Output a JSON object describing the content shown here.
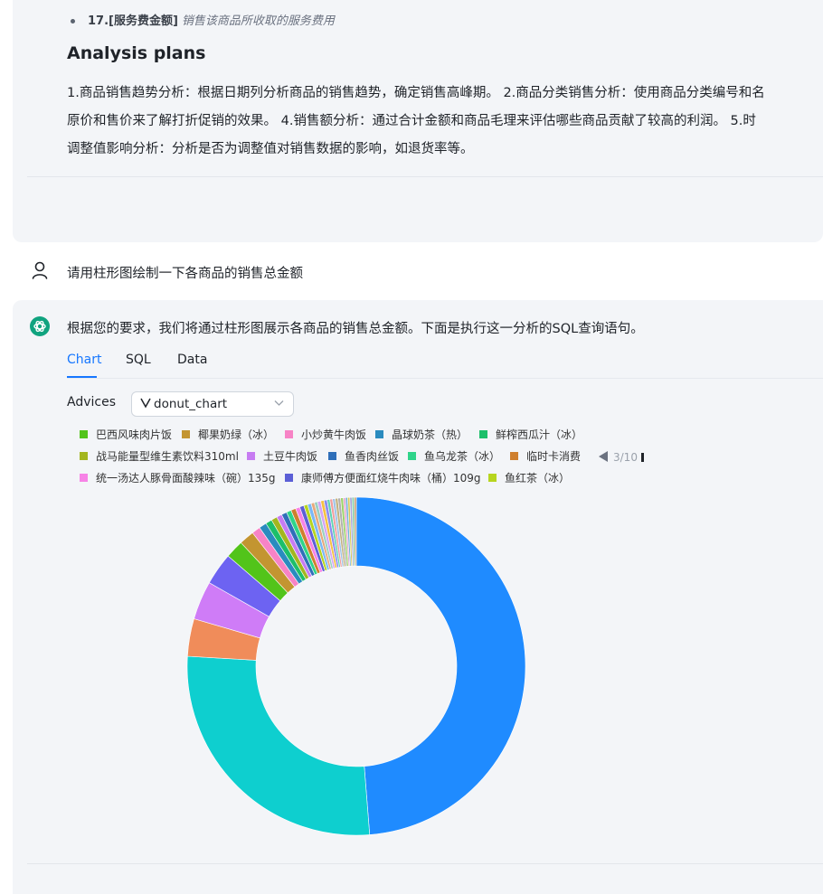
{
  "previous_message": {
    "bullet_number": "17.[服务费金额]",
    "bullet_desc": "销售该商品所收取的服务费用",
    "heading": "Analysis plans",
    "plan_lines": [
      "1.商品销售趋势分析：根据日期列分析商品的销售趋势，确定销售高峰期。 2.商品分类销售分析：使用商品分类编号和名",
      "原价和售价来了解打折促销的效果。 4.销售额分析：通过合计金额和商品毛理来评估哪些商品贡献了较高的利润。 5.时",
      "调整值影响分析：分析是否为调整值对销售数据的影响，如退货率等。"
    ]
  },
  "user_message": {
    "text": "请用柱形图绘制一下各商品的销售总金额"
  },
  "assistant_message": {
    "text": "根据您的要求，我们将通过柱形图展示各商品的销售总金额。下面是执行这一分析的SQL查询语句。",
    "tabs": [
      "Chart",
      "SQL",
      "Data"
    ],
    "active_tab": "Chart",
    "advices_label": "Advices",
    "advice_selected": "donut_chart"
  },
  "legend": {
    "items": [
      {
        "label": "巴西风味肉片饭",
        "color": "#52c41a"
      },
      {
        "label": "椰果奶绿（冰）",
        "color": "#c39531"
      },
      {
        "label": "小炒黄牛肉饭",
        "color": "#f783c6"
      },
      {
        "label": "晶球奶茶（热）",
        "color": "#2a8bbf"
      },
      {
        "label": "鲜榨西瓜汁（冰）",
        "color": "#1cbf6a"
      },
      {
        "label": "战马能量型维生素饮料310ml",
        "color": "#a3b61f"
      },
      {
        "label": "土豆牛肉饭",
        "color": "#c77cf2"
      },
      {
        "label": "鱼香肉丝饭",
        "color": "#2f6fb9"
      },
      {
        "label": "鱼乌龙茶（冰）",
        "color": "#2fd48a"
      },
      {
        "label": "临时卡消费",
        "color": "#cf7f2e"
      },
      {
        "label": "统一汤达人豚骨面酸辣味（碗）135g",
        "color": "#f783e6"
      },
      {
        "label": "康师傅方便面红烧牛肉味（桶）109g",
        "color": "#5b5fd6"
      },
      {
        "label": "鱼红茶（冰）",
        "color": "#b7d51f"
      }
    ],
    "pager": "3/10"
  },
  "chart_data": {
    "type": "pie",
    "subtype": "donut",
    "slices": [
      {
        "value": 47.5,
        "color": "#1f8bff"
      },
      {
        "value": 26.5,
        "color": "#0ecfcf"
      },
      {
        "value": 3.5,
        "color": "#f08c5a"
      },
      {
        "value": 3.6,
        "color": "#cf7cf7"
      },
      {
        "value": 3.0,
        "color": "#6d63f2"
      },
      {
        "value": 1.7,
        "color": "#52c41a"
      },
      {
        "value": 1.4,
        "color": "#c39531"
      },
      {
        "value": 0.8,
        "color": "#f783c6"
      },
      {
        "value": 0.7,
        "color": "#2a8bbf"
      },
      {
        "value": 0.6,
        "color": "#1cbf6a"
      },
      {
        "value": 0.55,
        "color": "#a3b61f"
      },
      {
        "value": 0.5,
        "color": "#c77cf2"
      },
      {
        "value": 0.5,
        "color": "#2f6fb9"
      },
      {
        "value": 0.45,
        "color": "#2fd48a"
      },
      {
        "value": 0.45,
        "color": "#cf7f2e"
      },
      {
        "value": 0.4,
        "color": "#f783e6"
      },
      {
        "value": 0.4,
        "color": "#5b5fd6"
      },
      {
        "value": 0.35,
        "color": "#b7d51f"
      },
      {
        "value": 0.35,
        "color": "#7ab8f5"
      },
      {
        "value": 0.3,
        "color": "#e8a87c"
      },
      {
        "value": 0.3,
        "color": "#9ad0c2"
      },
      {
        "value": 0.3,
        "color": "#d4a5f5"
      },
      {
        "value": 0.3,
        "color": "#f5c242"
      },
      {
        "value": 0.3,
        "color": "#8c8cf0"
      },
      {
        "value": 0.25,
        "color": "#5fd3b3"
      },
      {
        "value": 0.25,
        "color": "#f29e9e"
      },
      {
        "value": 0.25,
        "color": "#a0c4e8"
      },
      {
        "value": 0.25,
        "color": "#c2b280"
      },
      {
        "value": 0.25,
        "color": "#b0b0b0"
      },
      {
        "value": 0.25,
        "color": "#9fd36c"
      },
      {
        "value": 0.2,
        "color": "#e6a3d0"
      },
      {
        "value": 0.2,
        "color": "#6fb1d9"
      },
      {
        "value": 0.2,
        "color": "#d8c85a"
      },
      {
        "value": 0.2,
        "color": "#a7a7d8"
      },
      {
        "value": 0.2,
        "color": "#7fcba4"
      },
      {
        "value": 0.2,
        "color": "#c9a27a"
      }
    ]
  }
}
